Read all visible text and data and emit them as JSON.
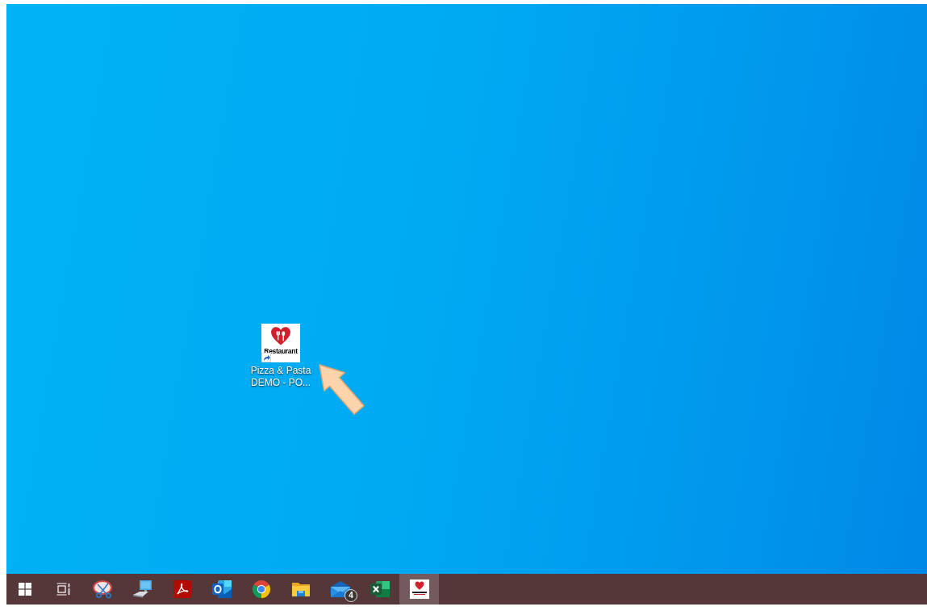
{
  "desktop": {
    "shortcuts": [
      {
        "label": "Pizza & Pasta DEMO - PO...",
        "logo_text": "Restaurant"
      }
    ]
  },
  "taskbar": {
    "items": [
      {
        "kind": "start",
        "selected": false
      },
      {
        "kind": "task_view",
        "selected": false
      },
      {
        "kind": "snipping",
        "selected": false
      },
      {
        "kind": "computer",
        "selected": false
      },
      {
        "kind": "pdf",
        "selected": false
      },
      {
        "kind": "outlook",
        "selected": false
      },
      {
        "kind": "browser",
        "selected": false
      },
      {
        "kind": "folder",
        "selected": false
      },
      {
        "kind": "mail",
        "selected": false,
        "badge": "4"
      },
      {
        "kind": "spreadsheet",
        "selected": false
      },
      {
        "kind": "app",
        "selected": true
      }
    ]
  }
}
